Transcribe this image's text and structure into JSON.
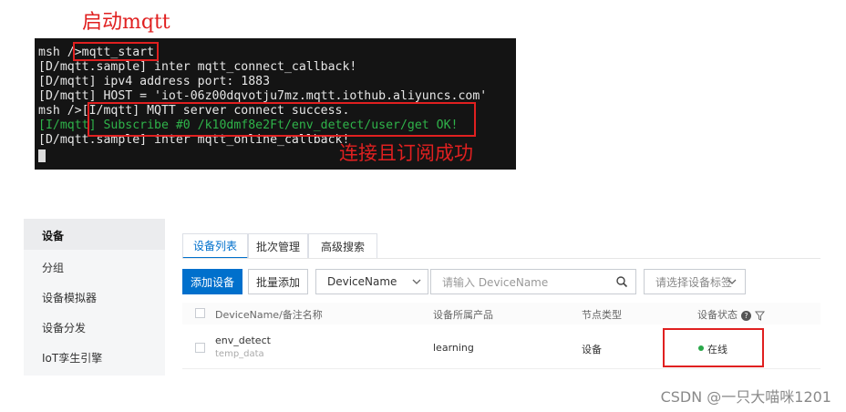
{
  "annotations": {
    "start_label": "启动mqtt",
    "success_label": "连接且订阅成功"
  },
  "terminal": {
    "lines": [
      "msh />mqtt_start",
      "[D/mqtt.sample] inter mqtt_connect_callback!",
      "[D/mqtt] ipv4 address port: 1883",
      "[D/mqtt] HOST = 'iot-06z00dqvotju7mz.mqtt.iothub.aliyuncs.com'",
      "msh />[I/mqtt] MQTT server connect success.",
      "[I/mqtt] Subscribe #0 /k10dmf8e2Ft/env_detect/user/get OK!",
      "[D/mqtt.sample] inter mqtt_online_callback!"
    ],
    "colors": {
      "text": "#e6e6e6",
      "success": "#2fb34a",
      "highlight": "#e02020"
    }
  },
  "sidebar": {
    "items": [
      {
        "label": "设备"
      },
      {
        "label": "分组"
      },
      {
        "label": "设备模拟器"
      },
      {
        "label": "设备分发"
      },
      {
        "label": "IoT孪生引擎"
      }
    ]
  },
  "tabs": [
    {
      "label": "设备列表"
    },
    {
      "label": "批次管理"
    },
    {
      "label": "高级搜索"
    }
  ],
  "toolbar": {
    "add_label": "添加设备",
    "batch_label": "批量添加",
    "field_select": "DeviceName",
    "search_placeholder": "请输入 DeviceName",
    "tag_placeholder": "请选择设备标签"
  },
  "table": {
    "headers": {
      "name": "DeviceName/备注名称",
      "product": "设备所属产品",
      "node": "节点类型",
      "status": "设备状态"
    },
    "rows": [
      {
        "name": "env_detect",
        "note": "temp_data",
        "product": "learning",
        "node": "设备",
        "status": "在线"
      }
    ]
  },
  "accent": "#0070cc",
  "watermark": "CSDN @一只大喵咪1201"
}
